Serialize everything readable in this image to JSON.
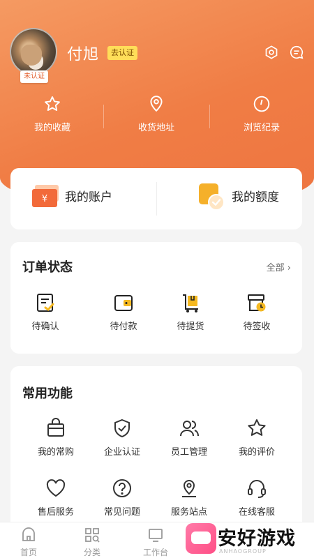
{
  "profile": {
    "username": "付旭",
    "verify_tag": "去认证",
    "status_badge": "未认证",
    "icons": [
      "settings-icon",
      "message-icon"
    ]
  },
  "quick_links": [
    {
      "label": "我的收藏",
      "icon": "star-icon"
    },
    {
      "label": "收货地址",
      "icon": "location-pin-icon"
    },
    {
      "label": "浏览纪录",
      "icon": "clock-icon"
    }
  ],
  "account": {
    "my_account": "我的账户",
    "my_quota": "我的额度"
  },
  "orders": {
    "title": "订单状态",
    "all_link": "全部",
    "items": [
      {
        "label": "待确认",
        "icon": "clipboard-check-icon"
      },
      {
        "label": "待付款",
        "icon": "wallet-icon"
      },
      {
        "label": "待提货",
        "icon": "cart-box-icon"
      },
      {
        "label": "待签收",
        "icon": "box-clock-icon"
      }
    ]
  },
  "tools": {
    "title": "常用功能",
    "items": [
      {
        "label": "我的常购",
        "icon": "shopping-bag-icon"
      },
      {
        "label": "企业认证",
        "icon": "shield-check-icon"
      },
      {
        "label": "员工管理",
        "icon": "users-icon"
      },
      {
        "label": "我的评价",
        "icon": "star-outline-icon"
      },
      {
        "label": "售后服务",
        "icon": "heart-icon"
      },
      {
        "label": "常见问题",
        "icon": "question-icon"
      },
      {
        "label": "服务站点",
        "icon": "map-pin-icon"
      },
      {
        "label": "在线客服",
        "icon": "headset-icon"
      }
    ]
  },
  "tabbar": [
    {
      "label": "首页",
      "icon": "home-icon"
    },
    {
      "label": "分类",
      "icon": "category-icon"
    },
    {
      "label": "工作台",
      "icon": "monitor-icon"
    }
  ],
  "watermark": {
    "text": "安好游戏",
    "sub": "ANHAOGROUP"
  },
  "colors": {
    "brand": "#f07d45",
    "accent_yellow": "#f5b921",
    "tag_yellow": "#ffde59"
  }
}
